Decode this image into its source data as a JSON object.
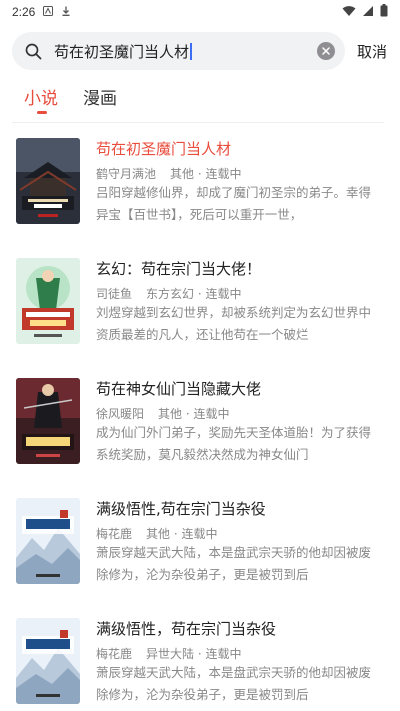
{
  "status_bar": {
    "time": "2:26",
    "icons": [
      "notification-a-icon",
      "download-icon",
      "wifi-icon",
      "signal-icon",
      "battery-icon"
    ]
  },
  "search": {
    "query": "苟在初圣魔门当人材",
    "cancel_label": "取消"
  },
  "tabs": [
    {
      "label": "小说",
      "active": true
    },
    {
      "label": "漫画",
      "active": false
    }
  ],
  "accent_color": "#e84c3d",
  "books": [
    {
      "title": "苟在初圣魔门当人材",
      "highlight": true,
      "author": "鹤守月满池",
      "category": "其他",
      "status": "连载中",
      "desc": "吕阳穿越修仙界，却成了魔门初圣宗的弟子。幸得异宝【百世书】，死后可以重开一世，",
      "cover_theme": "dark-temple"
    },
    {
      "title": "玄幻：苟在宗门当大佬！",
      "highlight": false,
      "author": "司徒鱼",
      "category": "东方玄幻",
      "status": "连载中",
      "desc": "刘煜穿越到玄幻世界，却被系统判定为玄幻世界中资质最差的凡人，还让他苟在一个破烂",
      "cover_theme": "green-hero"
    },
    {
      "title": "苟在神女仙门当隐藏大佬",
      "highlight": false,
      "author": "徐风暖阳",
      "category": "其他",
      "status": "连载中",
      "desc": "成为仙门外门弟子，奖励先天圣体道胎！为了获得系统奖励，莫凡毅然决然成为神女仙门",
      "cover_theme": "red-warrior"
    },
    {
      "title": "满级悟性,苟在宗门当杂役",
      "highlight": false,
      "author": "梅花鹿",
      "category": "其他",
      "status": "连载中",
      "desc": "萧辰穿越天武大陆，本是盘武宗天骄的他却因被废除修为，沦为杂役弟子，更是被罚到后",
      "cover_theme": "snow-mountain"
    },
    {
      "title": "满级悟性，苟在宗门当杂役",
      "highlight": false,
      "author": "梅花鹿",
      "category": "异世大陆",
      "status": "连载中",
      "desc": "萧辰穿越天武大陆，本是盘武宗天骄的他却因被废除修为，沦为杂役弟子，更是被罚到后",
      "cover_theme": "snow-mountain"
    }
  ]
}
